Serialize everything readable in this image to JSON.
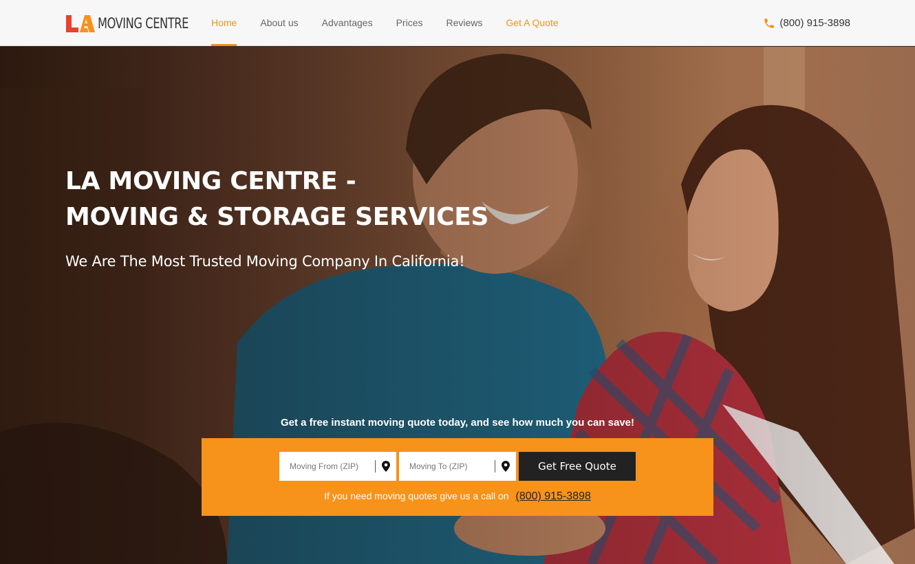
{
  "brand": {
    "logo_mark": "LA",
    "name": "MOVING CENTRE"
  },
  "nav": {
    "items": [
      {
        "label": "Home",
        "state": "active"
      },
      {
        "label": "About us",
        "state": "normal"
      },
      {
        "label": "Advantages",
        "state": "normal"
      },
      {
        "label": "Prices",
        "state": "normal"
      },
      {
        "label": "Reviews",
        "state": "normal"
      },
      {
        "label": "Get A Quote",
        "state": "accent"
      }
    ]
  },
  "header_phone": {
    "icon": "phone-icon",
    "number": "(800) 915-3898"
  },
  "hero": {
    "title_line1": "LA MOVING CENTRE -",
    "title_line2": "MOVING & STORAGE SERVICES",
    "subtitle": "We Are The Most Trusted Moving Company In California!",
    "promo": "Get a free instant moving quote today, and see how much you can save!"
  },
  "quote_form": {
    "from_placeholder": "Moving From (ZIP)",
    "to_placeholder": "Moving To (ZIP)",
    "pin_icon": "map-pin-icon",
    "submit_label": "Get Free Quote",
    "call_text": "If you need moving quotes give us a call on",
    "call_number": "(800) 915-3898"
  },
  "colors": {
    "accent": "#f7921a",
    "nav_active": "#f0911c",
    "dark_button": "#222222",
    "logo_red": "#e8412c"
  }
}
